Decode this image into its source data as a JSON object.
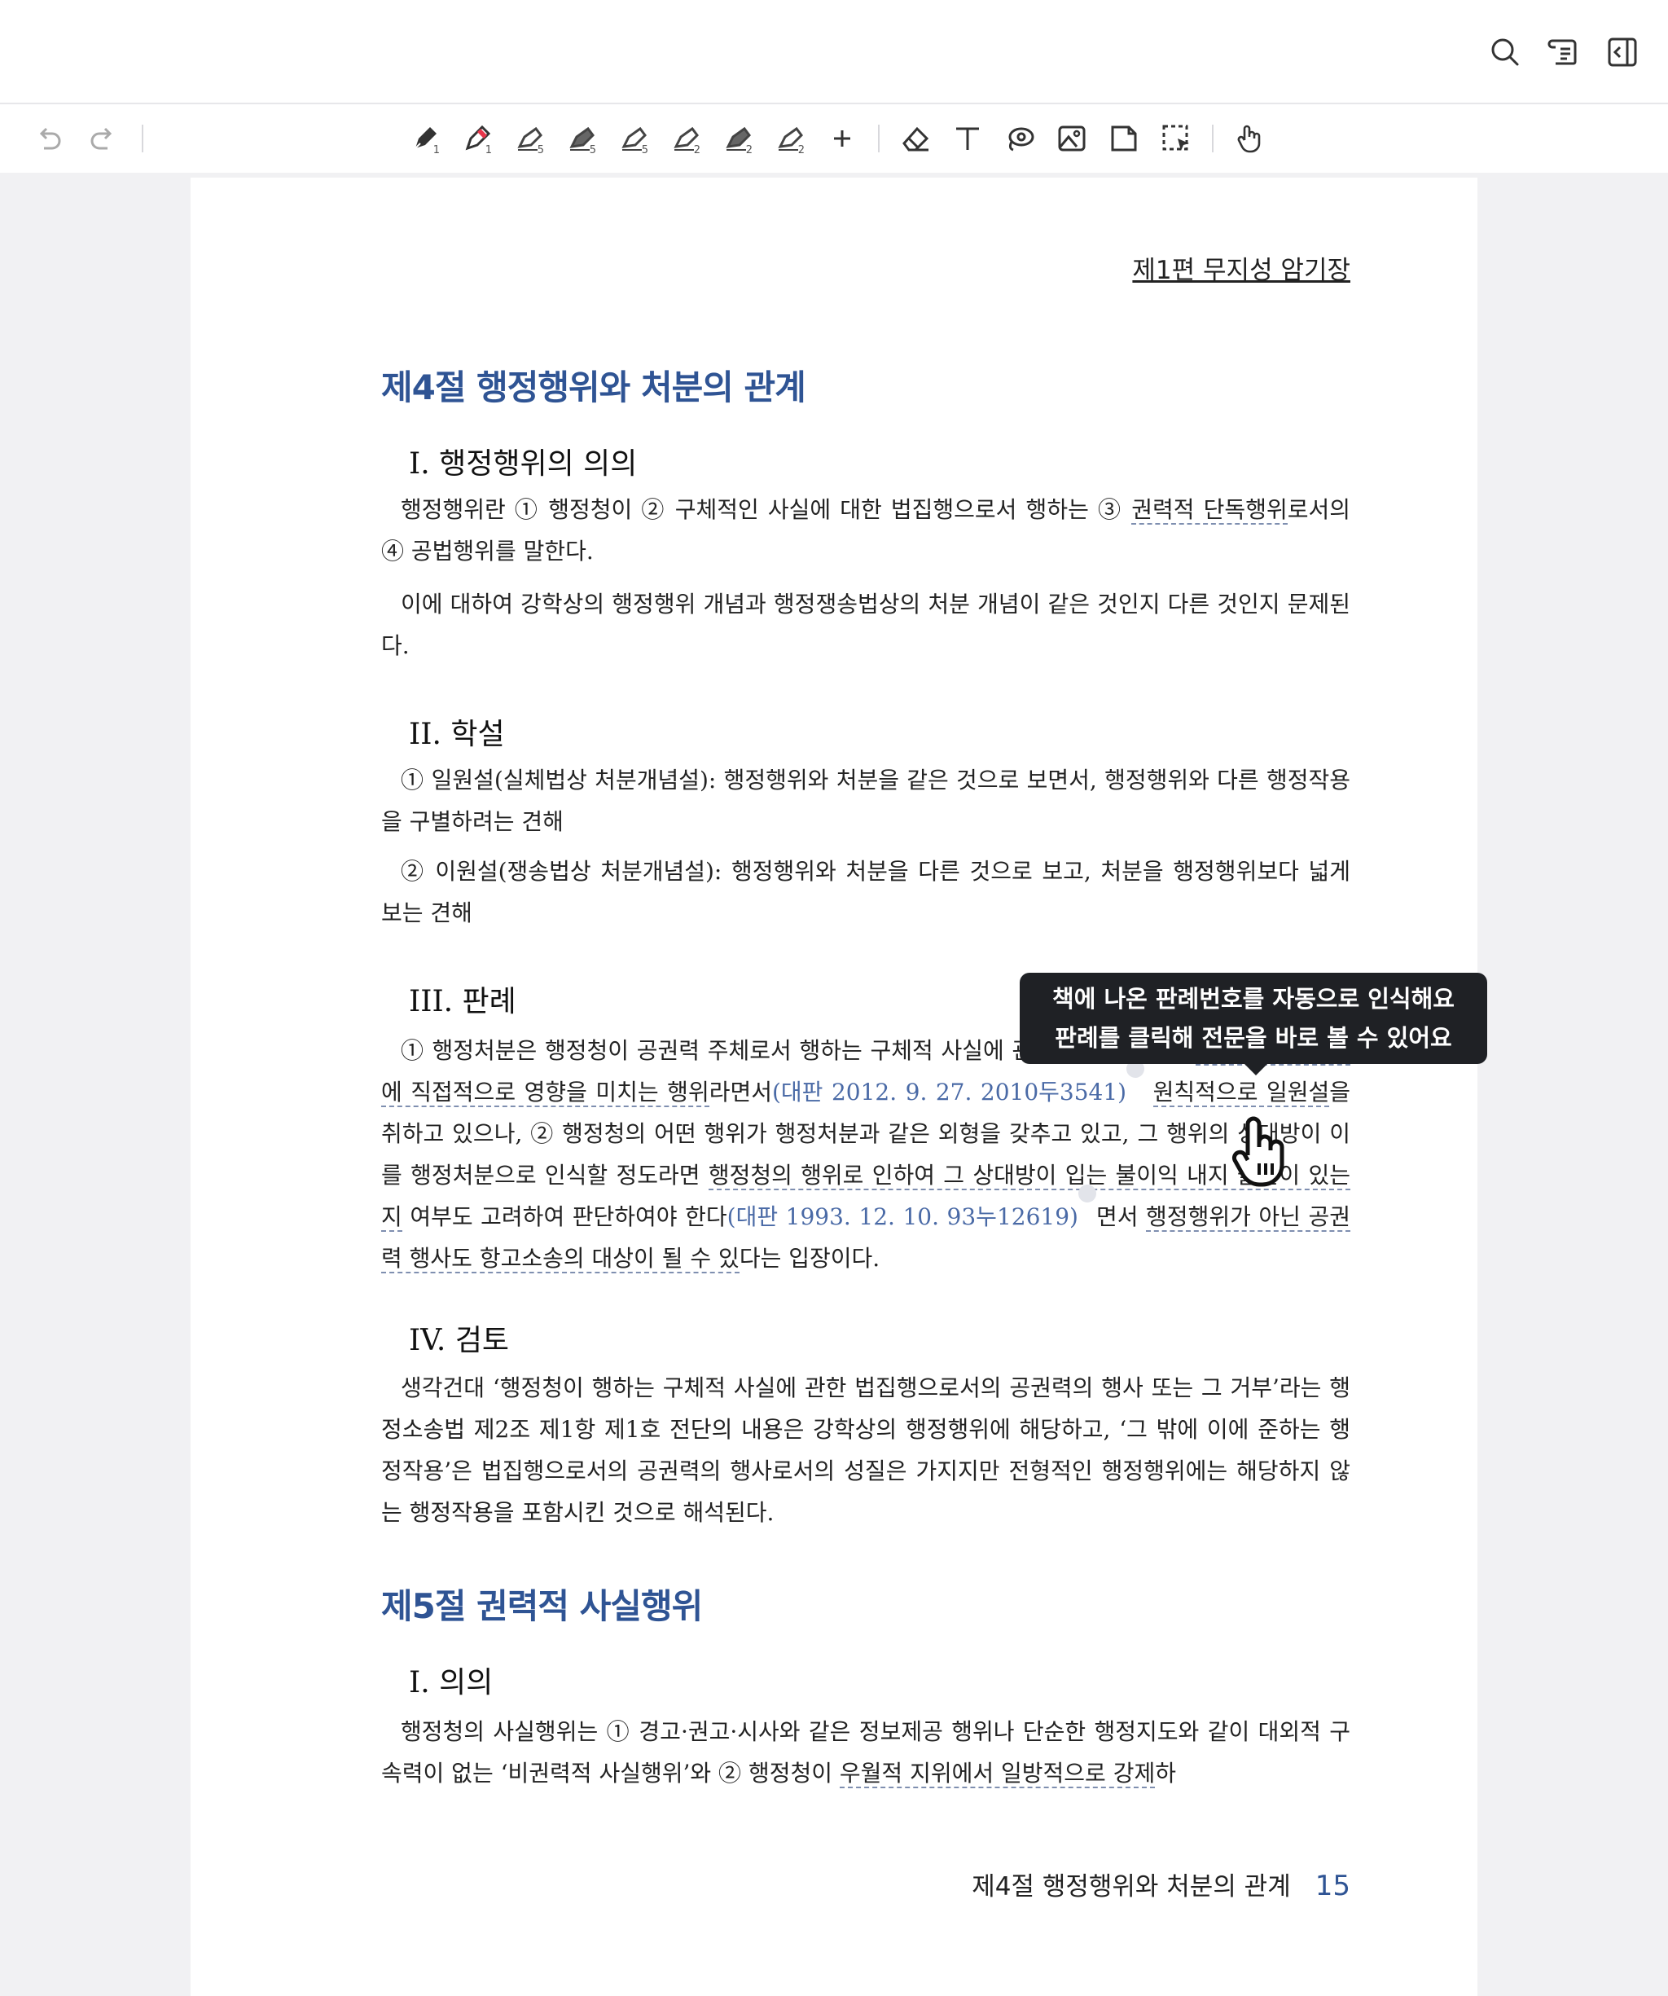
{
  "toolbar": {
    "pens": [
      {
        "name": "pen-black-icon",
        "size": "1"
      },
      {
        "name": "pen-red-icon",
        "size": "1"
      },
      {
        "name": "highlighter-icon",
        "size": "5"
      },
      {
        "name": "highlighter-icon",
        "size": "5"
      },
      {
        "name": "highlighter-icon",
        "size": "5"
      },
      {
        "name": "highlighter-icon",
        "size": "2"
      },
      {
        "name": "highlighter-icon",
        "size": "2"
      },
      {
        "name": "highlighter-icon",
        "size": "2"
      }
    ]
  },
  "doc": {
    "part_header": "제1편 무지성 암기장",
    "ch4_title": "제4절 행정행위와 처분의 관계",
    "s1_heading": "I. 행정행위의 의의",
    "s1_p1a": "행정행위란 ① 행정청이 ② 구체적인 사실에 대한 법집행으로서 행하는 ③ ",
    "s1_p1b": "권력적 단독행위",
    "s1_p1c": "로서의 ④ 공법행위를 말한다.",
    "s1_p2": "이에 대하여 강학상의 행정행위 개념과 행정쟁송법상의 처분 개념이 같은 것인지 다른 것인지 문제된다.",
    "s2_heading": "II. 학설",
    "s2_p1": "① 일원설(실체법상 처분개념설): 행정행위와 처분을 같은 것으로 보면서, 행정행위와 다른 행정작용을 구별하려는 견해",
    "s2_p2": "② 이원설(쟁송법상 처분개념설): 행정행위와 처분을 다른 것으로 보고, 처분을 행정행위보다 넓게 보는 견해",
    "s3_heading": "III. 판례",
    "s3_a": "① 행정처분은 행정청이 공권력 주체로서 행하는 구체적 사실에 관한 법집행으로서 ",
    "s3_b": "국민의 권리의무에 직접적으로 영향을 미치는 행위",
    "s3_c": "라면서",
    "s3_cite1": "(대판 2012. 9. 27. 2010두3541)",
    "s3_d": " ",
    "s3_e": "원칙적으로 일원설",
    "s3_f": "을 취하고 있으나, ② 행정청의 어떤 행위가 행정처분과 같은 외형을 갖추고 있고, 그 행위의 상대방이 이를 행정처분으로 인식할 정도라면 ",
    "s3_g": "행정청의 행위로 인하여 그 상대방이 입는 불이익 내지 불안이 있는지",
    "s3_h": " 여부도 고려하여 판단하여야 한다",
    "s3_cite2": "(대판 1993. 12. 10. 93누12619)",
    "s3_i": "면서 ",
    "s3_j": "행정행위가 아닌 공권력 행사도 항고소송의 대상이 될 수 있",
    "s3_k": "다는 입장이다.",
    "s4_heading": "IV. 검토",
    "s4_p1": "생각건대 ‘행정청이 행하는 구체적 사실에 관한 법집행으로서의 공권력의 행사 또는 그 거부’라는 행정소송법 제2조 제1항 제1호 전단의 내용은 강학상의 행정행위에 해당하고, ‘그 밖에 이에 준하는 행정작용’은 법집행으로서의 공권력의 행사로서의 성질은 가지지만 전형적인 행정행위에는 해당하지 않는 행정작용을 포함시킨 것으로 해석된다.",
    "ch5_title": "제5절 권력적 사실행위",
    "s5_heading": "I. 의의",
    "s5_a": "행정청의 사실행위는 ① 경고·권고·시사와 같은 정보제공 행위나 단순한 행정지도와 같이 대외적 구속력이 없는 ‘비권력적 사실행위’와 ② 행정청이 ",
    "s5_b": "우월적 지위에서 일방적으로 강제",
    "s5_c": "하",
    "footer_title": "제4절 행정행위와 처분의 관계",
    "page_number": "15"
  },
  "tooltip": {
    "line1": "책에 나온 판례번호를 자동으로 인식해요",
    "line2": "판례를 클릭해 전문을 바로 볼 수 있어요"
  }
}
